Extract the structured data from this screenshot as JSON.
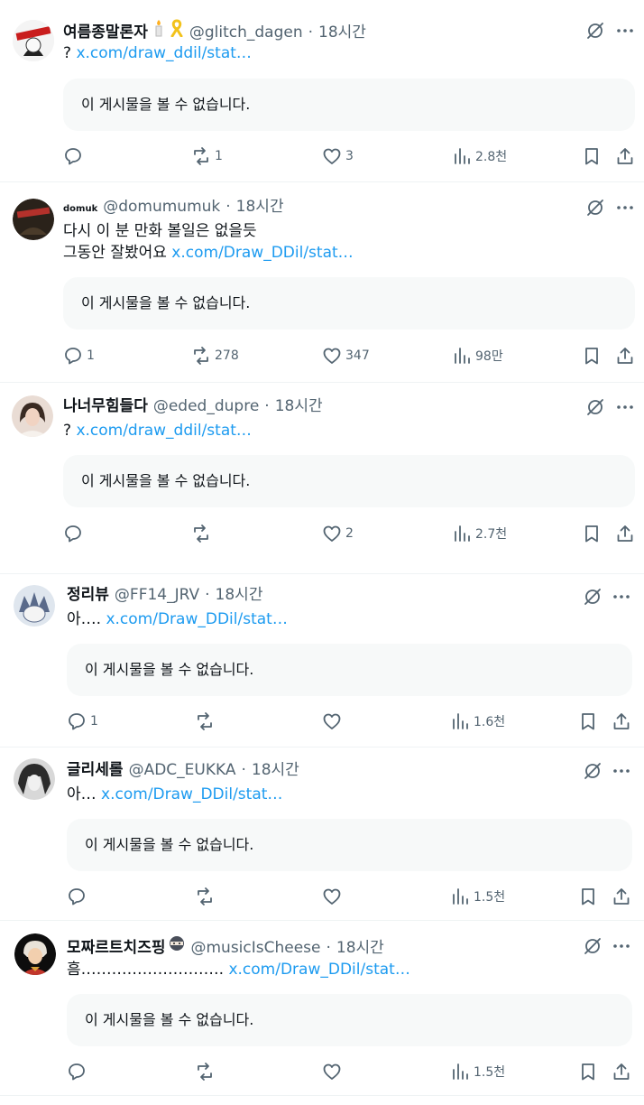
{
  "tweets": [
    {
      "name": "여름종말론자",
      "handle": "@glitch_dagen",
      "time": "18시간",
      "text_lines": [
        "?"
      ],
      "link": "x.com/draw_ddil/stat…",
      "quote_unavailable": "이 게시물을 볼 수 없습니다.",
      "replies": "",
      "reposts": "1",
      "likes": "3",
      "views": "2.8천",
      "avatar_colors": [
        "#f2f2f2",
        "#c91d1d"
      ],
      "name_emojis": [
        "candle-emoji-icon",
        "yellow-ribbon-icon"
      ]
    },
    {
      "name": "domuk",
      "handle": "@domumumuk",
      "time": "18시간",
      "text_lines": [
        "다시 이 분 만화 볼일은 없을듯",
        "그동안 잘봤어요"
      ],
      "link": "x.com/Draw_DDil/stat…",
      "quote_unavailable": "이 게시물을 볼 수 없습니다.",
      "replies": "1",
      "reposts": "278",
      "likes": "347",
      "views": "98만",
      "avatar_colors": [
        "#2a221a",
        "#b3312b"
      ]
    },
    {
      "name": "나너무힘들다",
      "handle": "@eded_dupre",
      "time": "18시간",
      "text_lines": [
        "?"
      ],
      "link": "x.com/draw_ddil/stat…",
      "quote_unavailable": "이 게시물을 볼 수 없습니다.",
      "replies": "",
      "reposts": "",
      "likes": "2",
      "views": "2.7천",
      "avatar_colors": [
        "#e9dcd4",
        "#3a2a22"
      ]
    },
    {
      "name": "정리뷰",
      "handle": "@FF14_JRV",
      "time": "18시간",
      "text_lines": [
        "아…."
      ],
      "link": "x.com/Draw_DDil/stat…",
      "quote_unavailable": "이 게시물을 볼 수 없습니다.",
      "replies": "1",
      "reposts": "",
      "likes": "",
      "views": "1.6천",
      "avatar_colors": [
        "#dfe6ee",
        "#5a6a8a"
      ]
    },
    {
      "name": "글리세롤",
      "handle": "@ADC_EUKKA",
      "time": "18시간",
      "text_lines": [
        "아…"
      ],
      "link": "x.com/Draw_DDil/stat…",
      "quote_unavailable": "이 게시물을 볼 수 없습니다.",
      "replies": "",
      "reposts": "",
      "likes": "",
      "views": "1.5천",
      "avatar_colors": [
        "#d8d8d8",
        "#2b2b2b"
      ]
    },
    {
      "name": "모짜르트치즈핑",
      "handle": "@musicIsCheese",
      "time": "18시간",
      "text_lines": [
        "흠………………………."
      ],
      "link": "x.com/Draw_DDil/stat…",
      "quote_unavailable": "이 게시물을 볼 수 없습니다.",
      "replies": "",
      "reposts": "",
      "likes": "",
      "views": "1.5천",
      "avatar_colors": [
        "#0d0d0d",
        "#d9a23b"
      ],
      "name_emojis": [
        "ninja-emoji-icon"
      ]
    }
  ],
  "icons": {
    "reply": "reply-icon",
    "repost": "repost-icon",
    "like": "like-icon",
    "views": "views-icon",
    "bookmark": "bookmark-icon",
    "share": "share-icon",
    "grok": "grok-icon",
    "more": "more-icon"
  },
  "colors": {
    "link": "#1d9bf0",
    "meta": "#536471",
    "quote_bg": "#f7f9f9"
  }
}
